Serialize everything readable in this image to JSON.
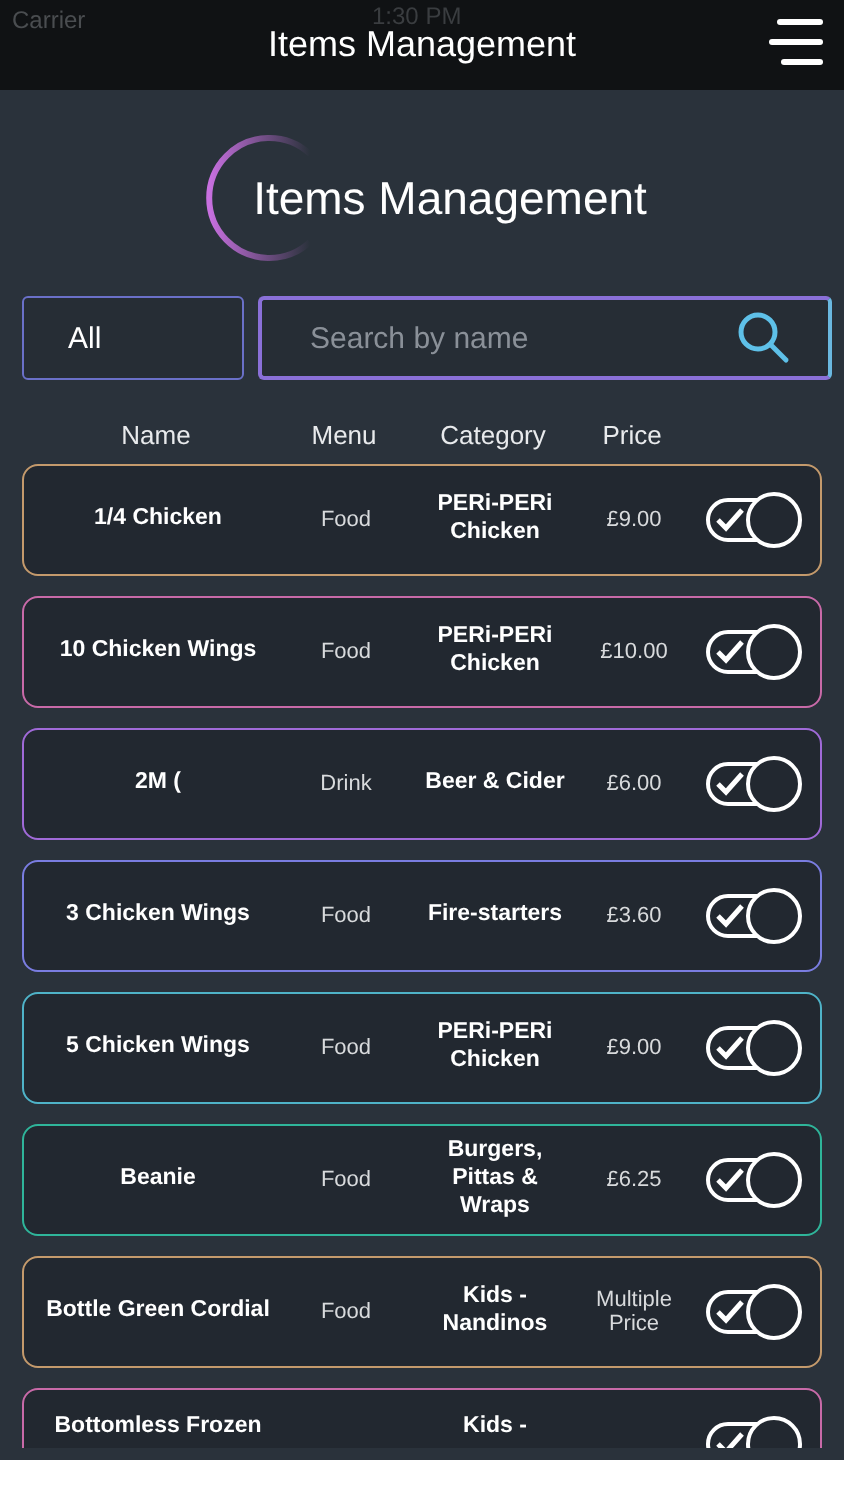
{
  "status_bar": {
    "carrier": "Carrier",
    "time": "1:30 PM"
  },
  "nav_bar": {
    "title": "Items Management"
  },
  "header": {
    "title": "Items Management"
  },
  "filter": {
    "value": "All"
  },
  "search": {
    "placeholder": "Search by name"
  },
  "table": {
    "columns": [
      "Name",
      "Menu",
      "Category",
      "Price"
    ],
    "rows": [
      {
        "name": "1/4 Chicken",
        "menu": "Food",
        "category": "PERi-PERi Chicken",
        "price": "£9.00",
        "on": true,
        "color": "#c49a6c"
      },
      {
        "name": "10 Chicken Wings",
        "menu": "Food",
        "category": "PERi-PERi Chicken",
        "price": "£10.00",
        "on": true,
        "color": "#c86aa8"
      },
      {
        "name": "2M (",
        "menu": "Drink",
        "category": "Beer & Cider",
        "price": "£6.00",
        "on": true,
        "color": "#a06ad8"
      },
      {
        "name": "3 Chicken Wings",
        "menu": "Food",
        "category": "Fire-starters",
        "price": "£3.60",
        "on": true,
        "color": "#7a7de0"
      },
      {
        "name": "5 Chicken Wings",
        "menu": "Food",
        "category": "PERi-PERi Chicken",
        "price": "£9.00",
        "on": true,
        "color": "#4fb3c8"
      },
      {
        "name": "Beanie",
        "menu": "Food",
        "category": "Burgers, Pittas & Wraps",
        "price": "£6.25",
        "on": true,
        "color": "#2fb59a"
      },
      {
        "name": "Bottle Green Cordial",
        "menu": "Food",
        "category": "Kids - Nandinos",
        "price": "Multiple Price",
        "on": true,
        "color": "#c49a6c"
      },
      {
        "name": "Bottomless Frozen",
        "category": "Kids -",
        "on": true,
        "color": "#c86aa8"
      }
    ]
  }
}
